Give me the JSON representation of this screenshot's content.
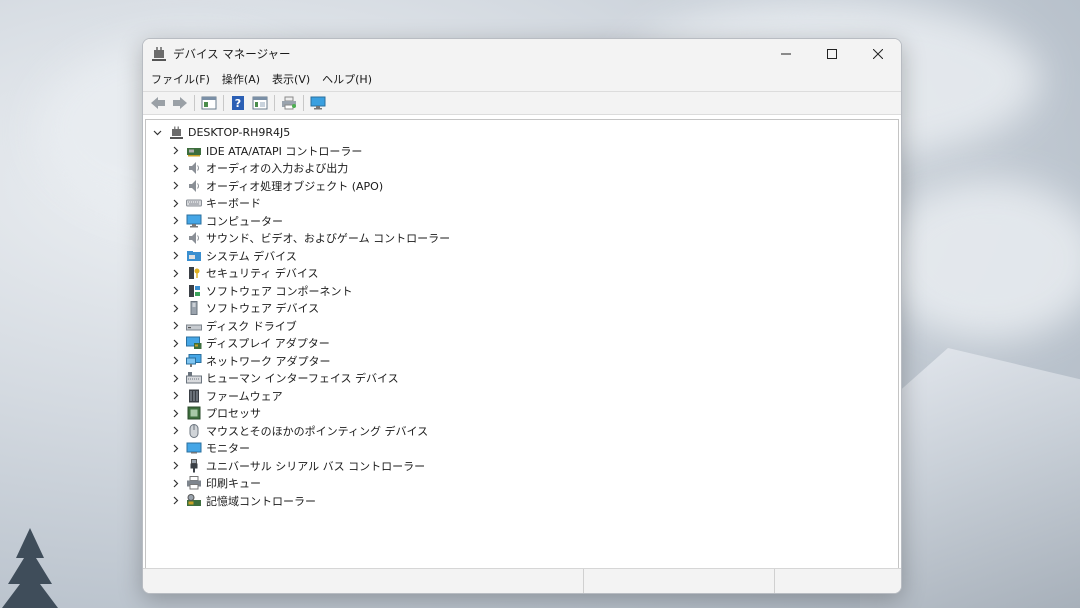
{
  "window": {
    "title": "デバイス マネージャー"
  },
  "menu": [
    {
      "label": "ファイル(F)"
    },
    {
      "label": "操作(A)"
    },
    {
      "label": "表示(V)"
    },
    {
      "label": "ヘルプ(H)"
    }
  ],
  "toolbar": [
    {
      "icon": "back-arrow-icon"
    },
    {
      "icon": "forward-arrow-icon"
    },
    {
      "icon": "properties-icon"
    },
    {
      "icon": "help-icon"
    },
    {
      "icon": "view-icon"
    },
    {
      "icon": "print-icon"
    },
    {
      "icon": "monitor-scan-icon"
    }
  ],
  "tree": {
    "root": "DESKTOP-RH9R4J5",
    "items": [
      {
        "label": "IDE ATA/ATAPI コントローラー",
        "icon": "ide-controller-icon"
      },
      {
        "label": "オーディオの入力および出力",
        "icon": "speaker-icon"
      },
      {
        "label": "オーディオ処理オブジェクト (APO)",
        "icon": "speaker-icon"
      },
      {
        "label": "キーボード",
        "icon": "keyboard-icon"
      },
      {
        "label": "コンピューター",
        "icon": "computer-icon"
      },
      {
        "label": "サウンド、ビデオ、およびゲーム コントローラー",
        "icon": "speaker-icon"
      },
      {
        "label": "システム デバイス",
        "icon": "system-folder-icon"
      },
      {
        "label": "セキュリティ デバイス",
        "icon": "security-key-icon"
      },
      {
        "label": "ソフトウェア コンポーネント",
        "icon": "software-component-icon"
      },
      {
        "label": "ソフトウェア デバイス",
        "icon": "software-device-icon"
      },
      {
        "label": "ディスク ドライブ",
        "icon": "disk-drive-icon"
      },
      {
        "label": "ディスプレイ アダプター",
        "icon": "display-adapter-icon"
      },
      {
        "label": "ネットワーク アダプター",
        "icon": "network-adapter-icon"
      },
      {
        "label": "ヒューマン インターフェイス デバイス",
        "icon": "hid-icon"
      },
      {
        "label": "ファームウェア",
        "icon": "firmware-icon"
      },
      {
        "label": "プロセッサ",
        "icon": "processor-icon"
      },
      {
        "label": "マウスとそのほかのポインティング デバイス",
        "icon": "mouse-icon"
      },
      {
        "label": "モニター",
        "icon": "monitor-icon"
      },
      {
        "label": "ユニバーサル シリアル バス コントローラー",
        "icon": "usb-icon"
      },
      {
        "label": "印刷キュー",
        "icon": "printer-icon"
      },
      {
        "label": "記憶域コントローラー",
        "icon": "storage-controller-icon"
      }
    ]
  },
  "colors": {
    "accent": "#1a73c9",
    "chrome": "#f3f3f3"
  }
}
